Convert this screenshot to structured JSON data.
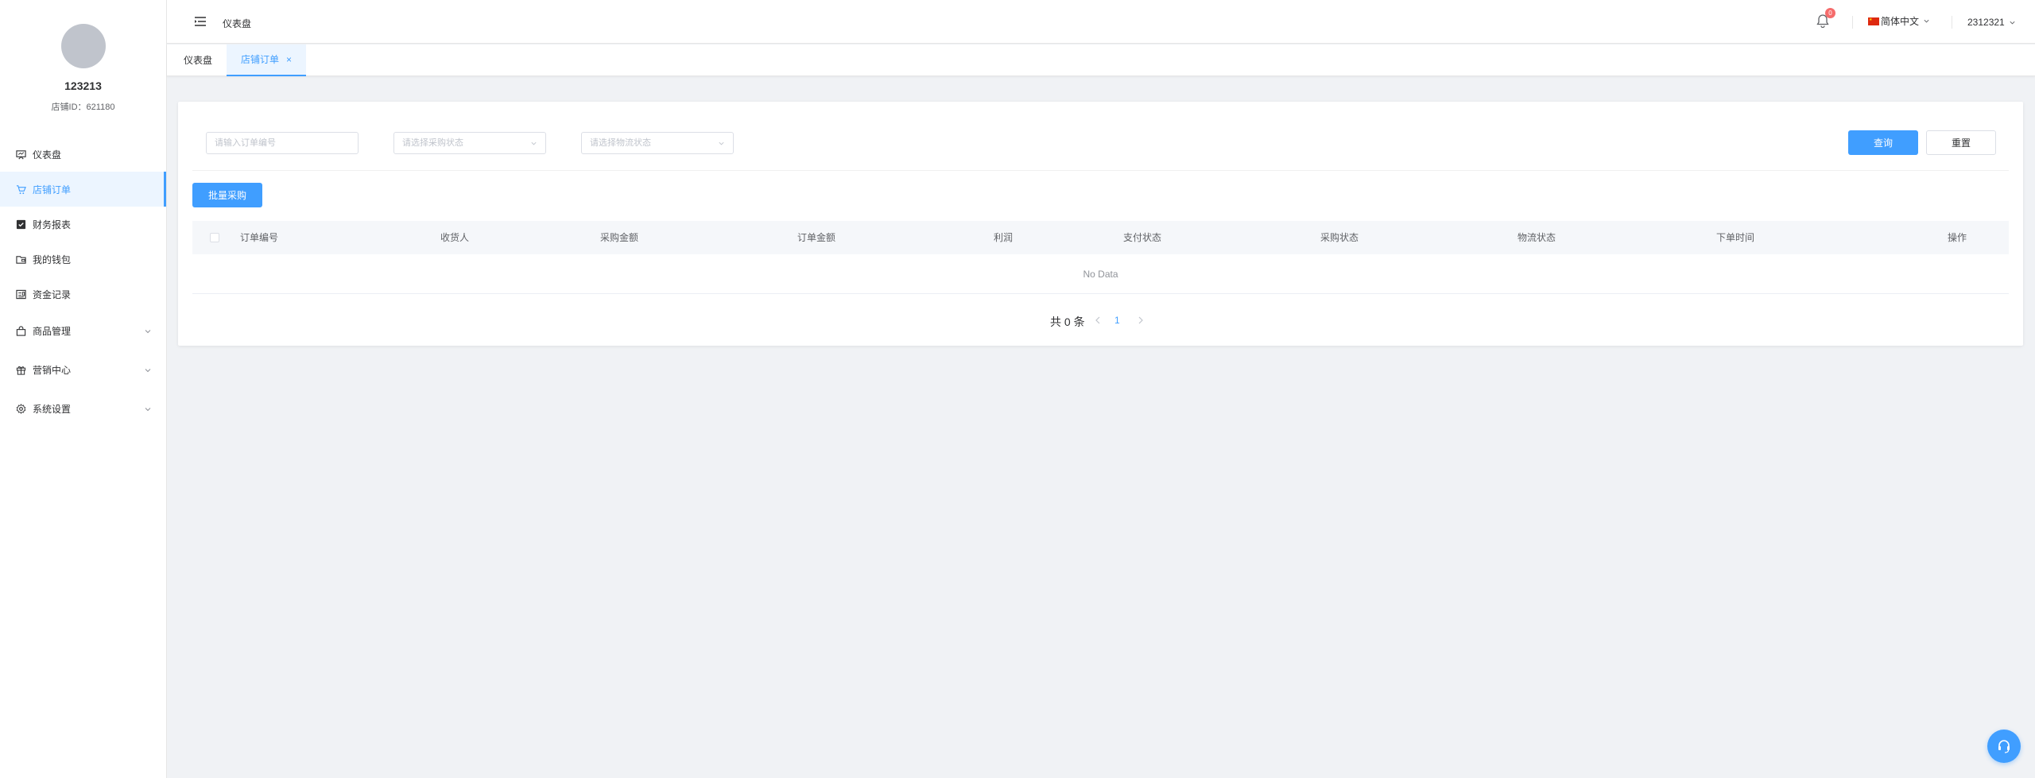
{
  "sidebar": {
    "profile": {
      "name": "123213",
      "store_id": "店铺ID：621180"
    },
    "items": [
      {
        "label": "仪表盘",
        "icon": "dashboard-icon"
      },
      {
        "label": "店铺订单",
        "icon": "cart-icon"
      },
      {
        "label": "财务报表",
        "icon": "report-icon"
      },
      {
        "label": "我的钱包",
        "icon": "wallet-icon"
      },
      {
        "label": "资金记录",
        "icon": "ledger-icon"
      },
      {
        "label": "商品管理",
        "icon": "bag-icon"
      },
      {
        "label": "营销中心",
        "icon": "gift-icon"
      },
      {
        "label": "系统设置",
        "icon": "gear-icon"
      }
    ]
  },
  "header": {
    "breadcrumb": "仪表盘",
    "notification_count": "0",
    "language": "简体中文",
    "username": "2312321"
  },
  "tabs": [
    {
      "label": "仪表盘"
    },
    {
      "label": "店铺订单",
      "close": "×"
    }
  ],
  "filters": {
    "order_no_placeholder": "请输入订单编号",
    "purchase_status_placeholder": "请选择采购状态",
    "logistics_status_placeholder": "请选择物流状态",
    "search_label": "查询",
    "reset_label": "重置"
  },
  "actions": {
    "bulk_purchase_label": "批量采购"
  },
  "table": {
    "columns": [
      "订单编号",
      "收货人",
      "采购金额",
      "订单金额",
      "利润",
      "支付状态",
      "采购状态",
      "物流状态",
      "下单时间",
      "操作"
    ],
    "empty_text": "No Data"
  },
  "pagination": {
    "total_text": "共 0 条",
    "current_page": "1"
  },
  "colors": {
    "accent": "#409eff",
    "badge": "#f56c6c",
    "background": "#f0f2f5"
  }
}
